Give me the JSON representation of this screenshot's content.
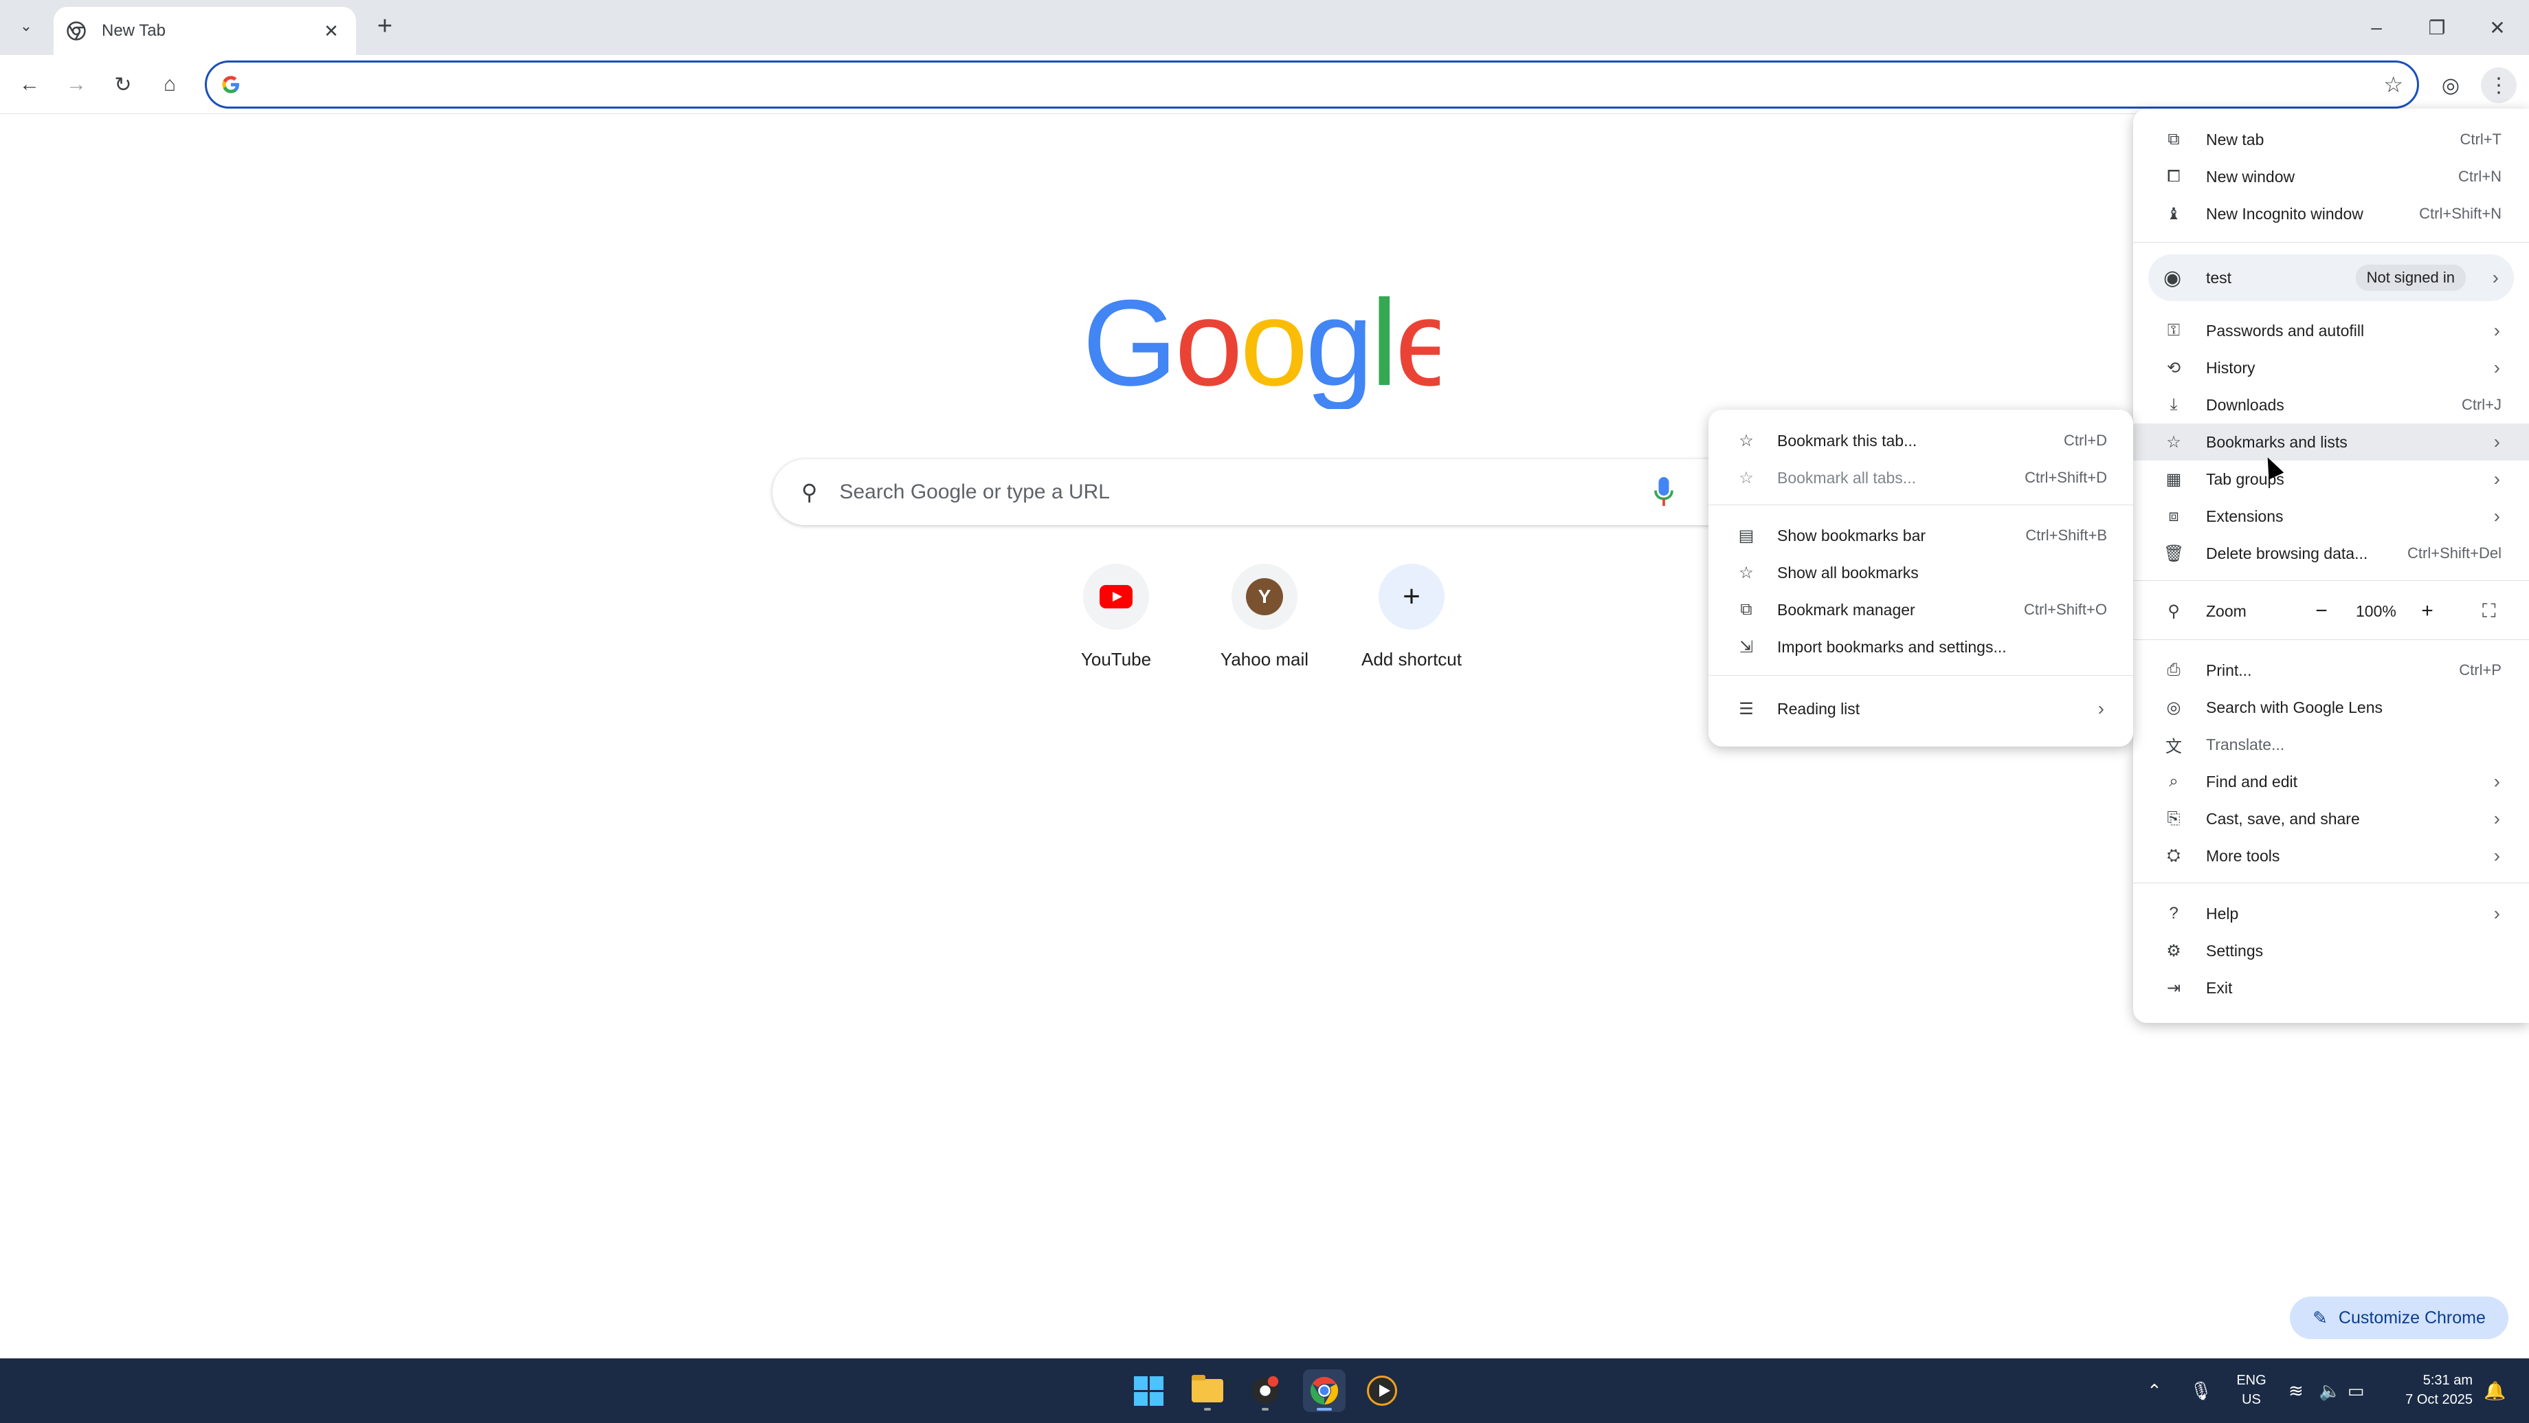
{
  "browser": {
    "tab_title": "New Tab",
    "omnibox_value": "",
    "omnibox_placeholder": ""
  },
  "ntp": {
    "search_placeholder": "Search Google or type a URL",
    "shortcuts": [
      {
        "label": "YouTube",
        "icon": "youtube-icon"
      },
      {
        "label": "Yahoo mail",
        "icon": "letter-y-icon",
        "letter": "Y"
      },
      {
        "label": "Add shortcut",
        "icon": "plus-icon"
      }
    ],
    "customize_label": "Customize Chrome"
  },
  "menu": {
    "new_tab": {
      "label": "New tab",
      "shortcut": "Ctrl+T"
    },
    "new_window": {
      "label": "New window",
      "shortcut": "Ctrl+N"
    },
    "new_incognito": {
      "label": "New Incognito window",
      "shortcut": "Ctrl+Shift+N"
    },
    "profile": {
      "name": "test",
      "status": "Not signed in"
    },
    "passwords": {
      "label": "Passwords and autofill"
    },
    "history": {
      "label": "History"
    },
    "downloads": {
      "label": "Downloads",
      "shortcut": "Ctrl+J"
    },
    "bookmarks": {
      "label": "Bookmarks and lists"
    },
    "tab_groups": {
      "label": "Tab groups"
    },
    "extensions": {
      "label": "Extensions"
    },
    "delete_data": {
      "label": "Delete browsing data...",
      "shortcut": "Ctrl+Shift+Del"
    },
    "zoom": {
      "label": "Zoom",
      "minus": "−",
      "value": "100%",
      "plus": "+"
    },
    "print": {
      "label": "Print...",
      "shortcut": "Ctrl+P"
    },
    "lens": {
      "label": "Search with Google Lens"
    },
    "translate": {
      "label": "Translate..."
    },
    "find_edit": {
      "label": "Find and edit"
    },
    "cast": {
      "label": "Cast, save, and share"
    },
    "more_tools": {
      "label": "More tools"
    },
    "help": {
      "label": "Help"
    },
    "settings": {
      "label": "Settings"
    },
    "exit": {
      "label": "Exit"
    }
  },
  "bookmarks_submenu": {
    "bookmark_tab": {
      "label": "Bookmark this tab...",
      "shortcut": "Ctrl+D"
    },
    "bookmark_all": {
      "label": "Bookmark all tabs...",
      "shortcut": "Ctrl+Shift+D"
    },
    "show_bar": {
      "label": "Show bookmarks bar",
      "shortcut": "Ctrl+Shift+B"
    },
    "show_all": {
      "label": "Show all bookmarks"
    },
    "manager": {
      "label": "Bookmark manager",
      "shortcut": "Ctrl+Shift+O"
    },
    "import": {
      "label": "Import bookmarks and settings..."
    },
    "reading_list": {
      "label": "Reading list"
    }
  },
  "taskbar": {
    "lang_top": "ENG",
    "lang_bottom": "US",
    "time": "5:31 am",
    "date": "7 Oct 2025"
  },
  "colors": {
    "accent": "#1a4fbd",
    "taskbar_bg": "#1b2b45",
    "customize_bg": "#d3e3fd"
  }
}
